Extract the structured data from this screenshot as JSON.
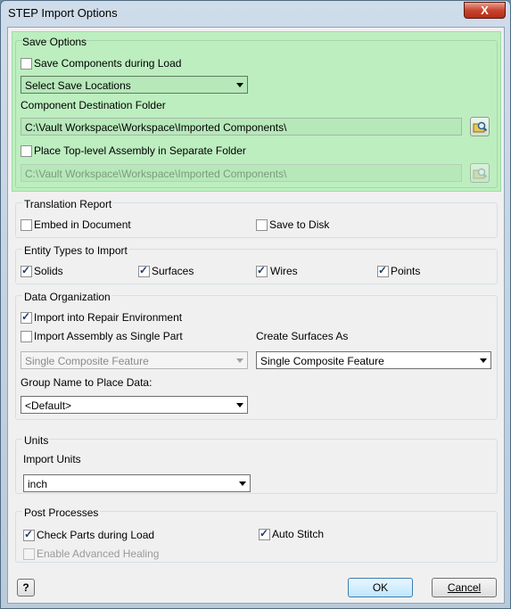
{
  "window": {
    "title": "STEP Import Options",
    "close_glyph": "X"
  },
  "save_options": {
    "title": "Save Options",
    "save_components_label": "Save Components during Load",
    "save_locations_select": "Select Save Locations",
    "dest_folder_label": "Component Destination Folder",
    "dest_folder_value": "C:\\Vault Workspace\\Workspace\\Imported Components\\",
    "place_top_level_label": "Place Top-level Assembly in Separate Folder",
    "top_level_folder_value": "C:\\Vault Workspace\\Workspace\\Imported Components\\",
    "highlight_color": "#bdeec0"
  },
  "translation_report": {
    "title": "Translation Report",
    "embed_label": "Embed in Document",
    "save_disk_label": "Save to Disk"
  },
  "entity_types": {
    "title": "Entity Types to Import",
    "solids": "Solids",
    "surfaces": "Surfaces",
    "wires": "Wires",
    "points": "Points"
  },
  "data_org": {
    "title": "Data Organization",
    "repair_env_label": "Import into Repair Environment",
    "single_part_label": "Import Assembly as Single Part",
    "create_surfaces_label": "Create Surfaces As",
    "single_part_select": "Single Composite Feature",
    "create_surfaces_select": "Single Composite Feature",
    "group_name_label": "Group Name to Place Data:",
    "group_name_select": "<Default>"
  },
  "units": {
    "title": "Units",
    "import_units_label": "Import Units",
    "units_select": "inch"
  },
  "post_processes": {
    "title": "Post Processes",
    "check_parts_label": "Check Parts during Load",
    "auto_stitch_label": "Auto Stitch",
    "advanced_healing_label": "Enable Advanced Healing"
  },
  "buttons": {
    "help": "?",
    "ok": "OK",
    "cancel": "Cancel"
  }
}
